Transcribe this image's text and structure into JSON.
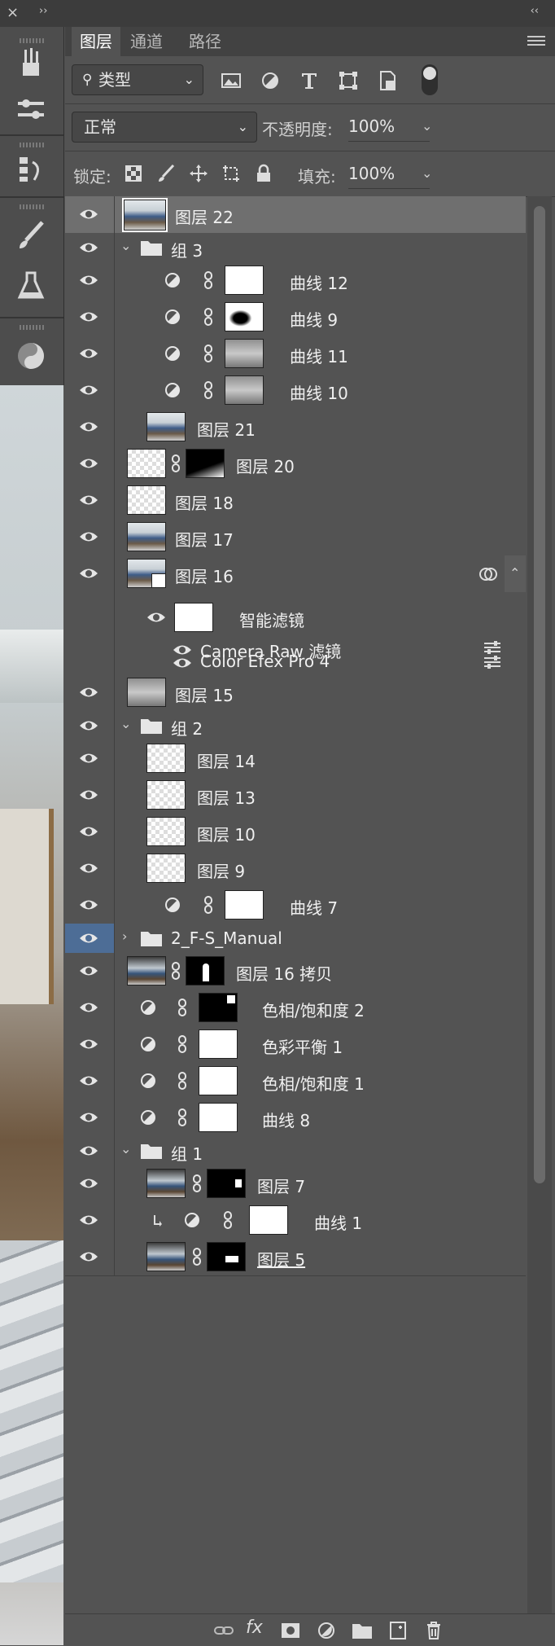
{
  "window": {
    "close": "×",
    "expand": "››",
    "collapse": "‹‹"
  },
  "tabs": [
    {
      "label": "图层",
      "active": true
    },
    {
      "label": "通道",
      "active": false
    },
    {
      "label": "路径",
      "active": false
    }
  ],
  "filter": {
    "kind_label": "类型",
    "icons": [
      "image-filter-icon",
      "adjustment-filter-icon",
      "type-filter-icon",
      "shape-filter-icon",
      "smart-object-filter-icon"
    ]
  },
  "blend": {
    "mode": "正常",
    "opacity_label": "不透明度:",
    "opacity_value": "100%"
  },
  "lock": {
    "label": "锁定:",
    "fill_label": "填充:",
    "fill_value": "100%"
  },
  "layers": [
    {
      "name": "图层 22",
      "thumb": "photo",
      "selected": true
    },
    {
      "name": "组 3",
      "type": "group",
      "expanded": true
    },
    {
      "name": "曲线 12",
      "type": "adjustment",
      "mask": "white"
    },
    {
      "name": "曲线 9",
      "type": "adjustment",
      "mask": "spot"
    },
    {
      "name": "曲线 11",
      "type": "adjustment",
      "mask": "gray"
    },
    {
      "name": "曲线 10",
      "type": "adjustment",
      "mask": "gray"
    },
    {
      "name": "图层 21",
      "thumb": "photo"
    },
    {
      "name": "图层 20",
      "thumb": "trans",
      "mask": "black"
    },
    {
      "name": "图层 18",
      "thumb": "trans"
    },
    {
      "name": "图层 17",
      "thumb": "photo"
    },
    {
      "name": "图层 16",
      "thumb": "smart",
      "smart_filters": {
        "label": "智能滤镜",
        "items": [
          "Camera Raw 滤镜",
          "Color Efex Pro 4"
        ]
      }
    },
    {
      "name": "图层 15",
      "thumb": "gray"
    },
    {
      "name": "组 2",
      "type": "group",
      "expanded": true
    },
    {
      "name": "图层 14",
      "thumb": "trans"
    },
    {
      "name": "图层 13",
      "thumb": "trans"
    },
    {
      "name": "图层 10",
      "thumb": "trans"
    },
    {
      "name": "图层 9",
      "thumb": "trans"
    },
    {
      "name": "曲线 7",
      "type": "adjustment",
      "mask": "white"
    },
    {
      "name": "2_F-S_Manual",
      "type": "group",
      "expanded": false
    },
    {
      "name": "图层 16 拷贝",
      "thumb": "photo2",
      "mask": "figure"
    },
    {
      "name": "色相/饱和度 2",
      "type": "adjustment",
      "mask": "black"
    },
    {
      "name": "色彩平衡 1",
      "type": "adjustment",
      "mask": "white"
    },
    {
      "name": "色相/饱和度 1",
      "type": "adjustment",
      "mask": "white"
    },
    {
      "name": "曲线 8",
      "type": "adjustment",
      "mask": "white"
    },
    {
      "name": "组 1",
      "type": "group",
      "expanded": true
    },
    {
      "name": "图层 7",
      "thumb": "photo2",
      "mask": "black"
    },
    {
      "name": "曲线 1",
      "type": "adjustment",
      "mask": "white",
      "clipped": true
    },
    {
      "name": "图层 5",
      "thumb": "photo2",
      "mask": "black"
    }
  ],
  "bottom_bar": [
    "link-icon",
    "fx-icon",
    "add-mask-icon",
    "new-adjustment-icon",
    "new-group-icon",
    "new-layer-icon",
    "delete-icon"
  ],
  "fx_label": "fx"
}
